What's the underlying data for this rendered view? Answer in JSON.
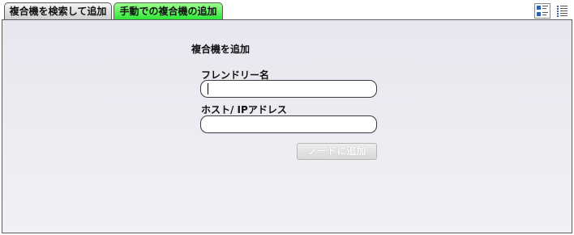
{
  "tabs": [
    {
      "label": "複合機を検索して追加",
      "active": false
    },
    {
      "label": "手動での複合機の追加",
      "active": true
    }
  ],
  "view_toggle": {
    "thumbnail_icon": "thumbnail-view-icon",
    "list_icon": "list-view-icon"
  },
  "form": {
    "title": "複合機を追加",
    "friendly_name_label": "フレンドリー名",
    "friendly_name_value": "",
    "host_label": "ホスト/ IPアドレス",
    "host_value": "",
    "add_button_label": "ノードに追加",
    "add_button_enabled": false
  },
  "colors": {
    "active_tab": "#2fe63a",
    "panel_background": "#ece9f1"
  }
}
